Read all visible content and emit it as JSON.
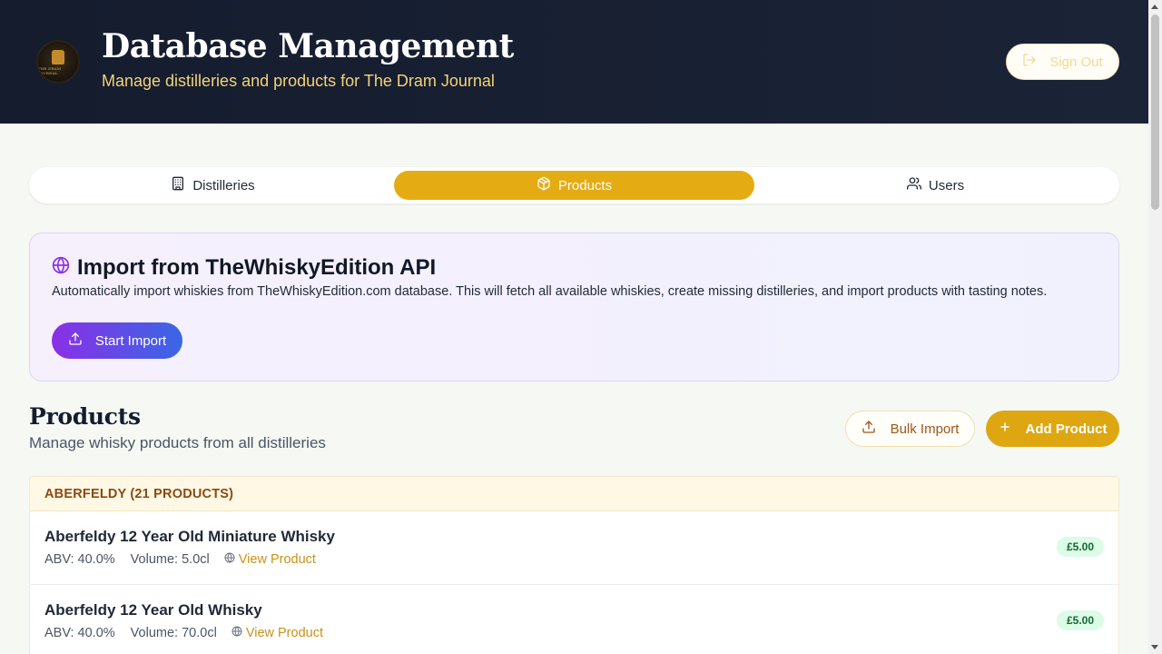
{
  "header": {
    "title": "Database Management",
    "subtitle": "Manage distilleries and products for The Dram Journal",
    "logo_text": "THE DRAM JOURNAL",
    "sign_out_label": "Sign Out"
  },
  "tabs": [
    {
      "label": "Distilleries",
      "icon": "building-icon",
      "active": false
    },
    {
      "label": "Products",
      "icon": "box-icon",
      "active": true
    },
    {
      "label": "Users",
      "icon": "users-icon",
      "active": false
    }
  ],
  "import_card": {
    "title": "Import from TheWhiskyEdition API",
    "description": "Automatically import whiskies from TheWhiskyEdition.com database. This will fetch all available whiskies, create missing distilleries, and import products with tasting notes.",
    "button_label": "Start Import"
  },
  "products_section": {
    "title": "Products",
    "subtitle": "Manage whisky products from all distilleries",
    "bulk_import_label": "Bulk Import",
    "add_product_label": "Add Product"
  },
  "groups": [
    {
      "heading": "ABERFELDY (21 PRODUCTS)",
      "products": [
        {
          "name": "Aberfeldy 12 Year Old Miniature Whisky",
          "abv_label": "ABV:",
          "abv": "40.0%",
          "volume_label": "Volume:",
          "volume": "5.0cl",
          "link": "View Product",
          "price": "£5.00"
        },
        {
          "name": "Aberfeldy 12 Year Old Whisky",
          "abv_label": "ABV:",
          "abv": "40.0%",
          "volume_label": "Volume:",
          "volume": "70.0cl",
          "link": "View Product",
          "price": "£5.00"
        }
      ]
    }
  ],
  "colors": {
    "header_bg": "#141c2e",
    "accent_gold": "#e4ac12",
    "subtitle_gold": "#f3d27a",
    "import_gradient_start": "#8b2fe6",
    "import_gradient_end": "#3967e6",
    "price_badge_bg": "#dcfce7",
    "price_badge_text": "#166534"
  }
}
